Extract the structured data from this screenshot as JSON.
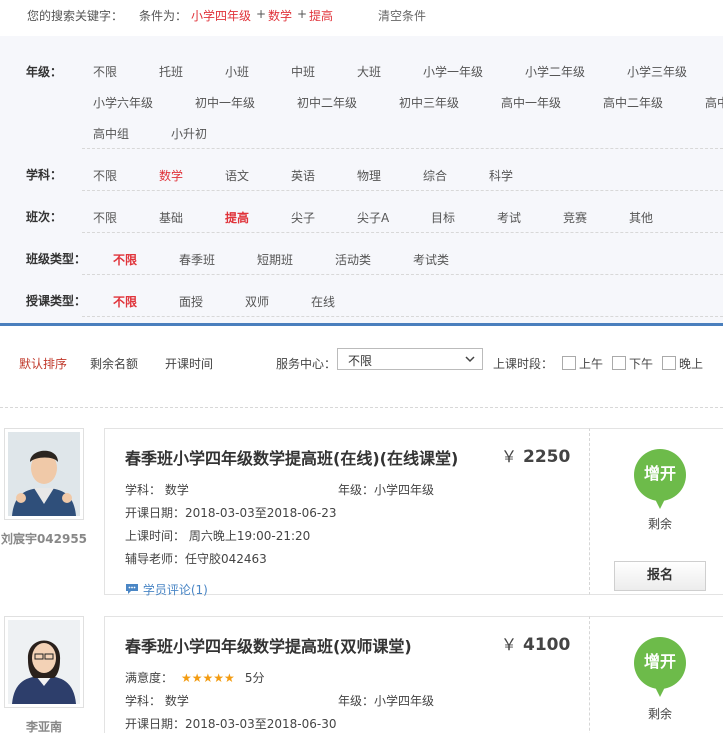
{
  "keyword_bar": {
    "label": "您的搜索关键字：",
    "cond_label": "条件为：",
    "cond_parts": [
      "小学四年级",
      "+",
      "数学",
      "+",
      "提高"
    ],
    "clear": "清空条件"
  },
  "filters": {
    "grade": {
      "label": "年级：",
      "options": [
        "不限",
        "托班",
        "小班",
        "中班",
        "大班",
        "小学一年级",
        "小学二年级",
        "小学三年级",
        "小学六年级",
        "初中一年级",
        "初中二年级",
        "初中三年级",
        "高中一年级",
        "高中二年级",
        "高中",
        "高中组",
        "小升初"
      ]
    },
    "subject": {
      "label": "学科：",
      "options": [
        "不限",
        "数学",
        "语文",
        "英语",
        "物理",
        "综合",
        "科学"
      ],
      "selected": "数学"
    },
    "level": {
      "label": "班次：",
      "options": [
        "不限",
        "基础",
        "提高",
        "尖子",
        "尖子A",
        "目标",
        "考试",
        "竞赛",
        "其他"
      ],
      "selected": "提高"
    },
    "class_type": {
      "label": "班级类型：",
      "options": [
        "不限",
        "春季班",
        "短期班",
        "活动类",
        "考试类"
      ],
      "selected": "不限"
    },
    "teach_type": {
      "label": "授课类型：",
      "options": [
        "不限",
        "面授",
        "双师",
        "在线"
      ],
      "selected": "不限"
    }
  },
  "sortbar": {
    "sorts": [
      "默认排序",
      "剩余名额",
      "开课时间"
    ],
    "service_label": "服务中心：",
    "service_value": "不限",
    "time_label": "上课时段：",
    "periods": [
      "上午",
      "下午",
      "晚上"
    ]
  },
  "courses": [
    {
      "teacher": "刘宸宇042955",
      "title": "春季班小学四年级数学提高班(在线)(在线课堂)",
      "currency": "￥",
      "price": "2250",
      "subject": "学科：  数学",
      "grade": "年级：小学四年级",
      "start": "开课日期：2018-03-03至2018-06-23",
      "time": "上课时间：  周六晚上19:00-21:20",
      "tutor": "辅导老师：任守胶042463",
      "review": "学员评论(1)",
      "badge": "增开",
      "remain": "剩余",
      "signup": "报名"
    },
    {
      "teacher": "李亚南",
      "title": "春季班小学四年级数学提高班(双师课堂)",
      "currency": "￥",
      "price": "4100",
      "satisfaction": "满意度：",
      "stars": "★★★★★",
      "score": "5分",
      "subject": "学科：  数学",
      "grade": "年级：小学四年级",
      "start": "开课日期：2018-03-03至2018-06-30",
      "badge": "增开",
      "remain": "剩余"
    }
  ],
  "colors": {
    "accent_red": "#e0333a",
    "blue_divider": "#4a7fbd",
    "badge_green": "#6dbb4a",
    "star": "#f39c12"
  }
}
